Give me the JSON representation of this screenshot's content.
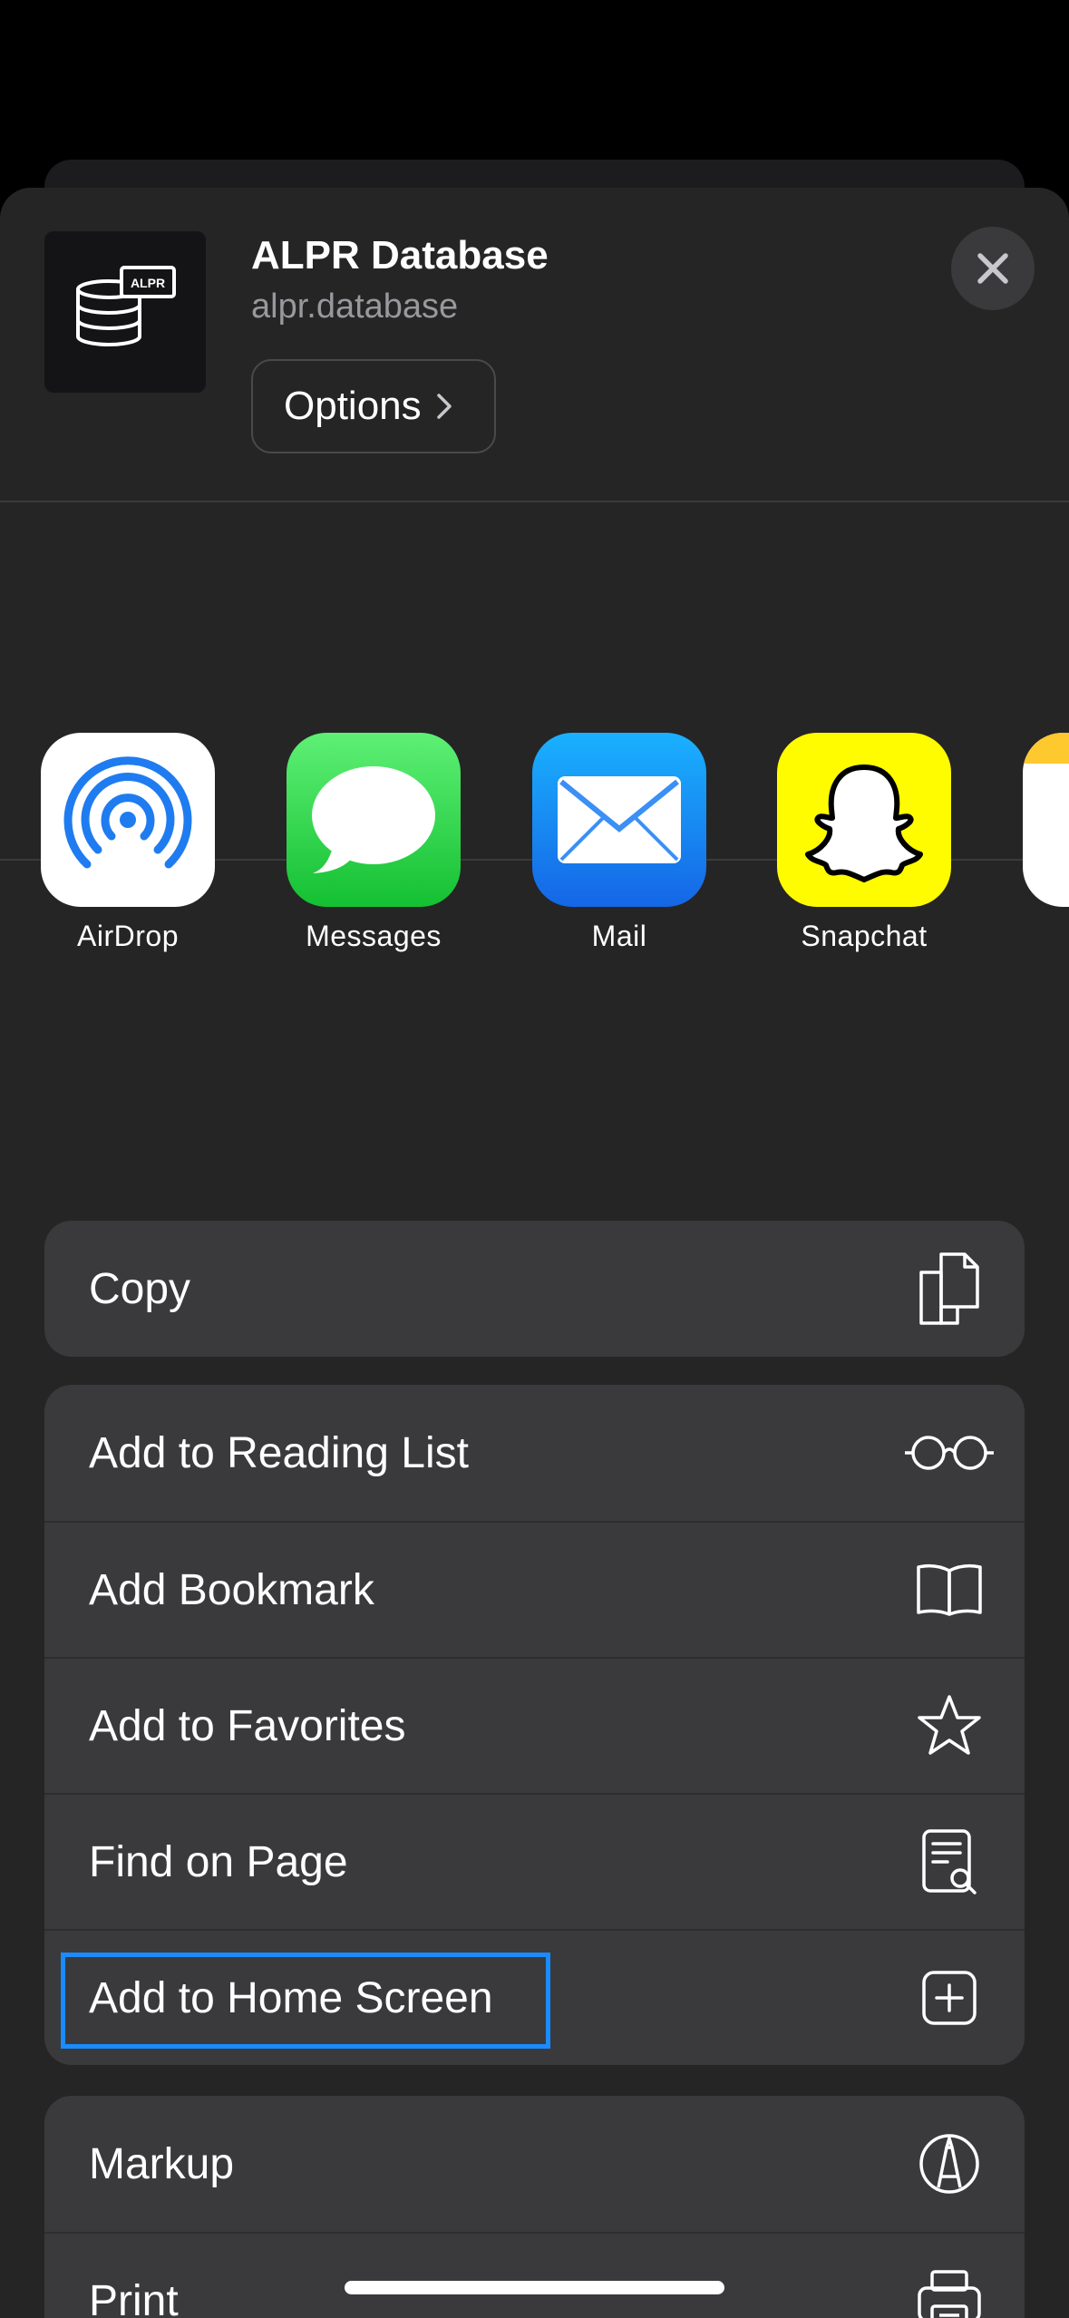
{
  "header": {
    "title": "ALPR Database",
    "url": "alpr.database",
    "options_label": "Options",
    "thumb_badge": "ALPR"
  },
  "apps": [
    {
      "label": "AirDrop",
      "icon": "airdrop-icon",
      "color": "#ffffff"
    },
    {
      "label": "Messages",
      "icon": "messages-icon",
      "color": "#2fce4f"
    },
    {
      "label": "Mail",
      "icon": "mail-icon",
      "color": "#1f8cf7"
    },
    {
      "label": "Snapchat",
      "icon": "snapchat-icon",
      "color": "#fffc00"
    }
  ],
  "groups": {
    "copy": [
      {
        "label": "Copy",
        "icon": "copy-icon"
      }
    ],
    "main": [
      {
        "label": "Add to Reading List",
        "icon": "glasses-icon"
      },
      {
        "label": "Add Bookmark",
        "icon": "book-icon"
      },
      {
        "label": "Add to Favorites",
        "icon": "star-icon"
      },
      {
        "label": "Find on Page",
        "icon": "find-on-page-icon"
      },
      {
        "label": "Add to Home Screen",
        "icon": "plus-square-icon",
        "highlighted": true
      }
    ],
    "more": [
      {
        "label": "Markup",
        "icon": "markup-icon"
      },
      {
        "label": "Print",
        "icon": "printer-icon"
      }
    ]
  },
  "colors": {
    "sheet": "#252525",
    "row": "#3a3a3c",
    "highlight": "#1a8cff"
  }
}
